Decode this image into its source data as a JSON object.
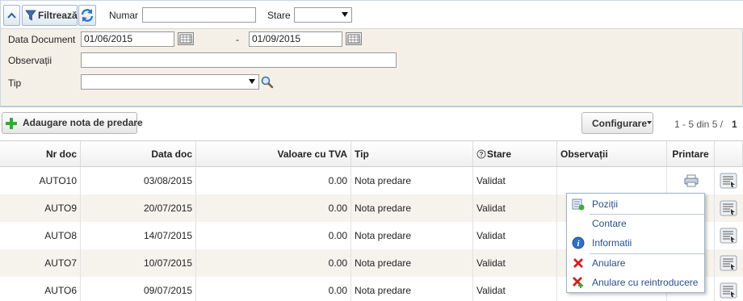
{
  "filter": {
    "toggle_label": "^",
    "filter_button_label": "Filtrează",
    "numar_label": "Numar",
    "numar_value": "",
    "stare_label": "Stare",
    "stare_value": "",
    "data_document_label": "Data Document",
    "date_from": "01/06/2015",
    "date_separator": "-",
    "date_to": "01/09/2015",
    "observatii_label": "Observații",
    "observatii_value": "",
    "tip_label": "Tip",
    "tip_value": ""
  },
  "actions": {
    "add_label": "Adaugare nota de predare",
    "config_label": "Configurare",
    "pagination_text": "1 - 5 din 5 /",
    "page_number": "1"
  },
  "table": {
    "columns": [
      "Nr doc",
      "Data doc",
      "Valoare cu TVA",
      "Tip",
      "Stare",
      "Observații",
      "Printare"
    ],
    "rows": [
      {
        "nr": "AUTO10",
        "data": "03/08/2015",
        "valoare": "0.00",
        "tip": "Nota predare",
        "stare": "Validat",
        "obs": ""
      },
      {
        "nr": "AUTO9",
        "data": "20/07/2015",
        "valoare": "0.00",
        "tip": "Nota predare",
        "stare": "Validat",
        "obs": ""
      },
      {
        "nr": "AUTO8",
        "data": "14/07/2015",
        "valoare": "0.00",
        "tip": "Nota predare",
        "stare": "Validat",
        "obs": ""
      },
      {
        "nr": "AUTO7",
        "data": "10/07/2015",
        "valoare": "0.00",
        "tip": "Nota predare",
        "stare": "Validat",
        "obs": ""
      },
      {
        "nr": "AUTO6",
        "data": "09/07/2015",
        "valoare": "0.00",
        "tip": "Nota predare",
        "stare": "Validat",
        "obs": ""
      }
    ]
  },
  "context_menu": {
    "items": [
      "Poziții",
      "Contare",
      "Informatii",
      "Anulare",
      "Anulare cu reintroducere"
    ]
  },
  "colors": {
    "panel_bg": "#f5f0e7",
    "alt_row_bg": "#f6f3ec",
    "menu_text": "#2a4f86",
    "add_green": "#3aa63a",
    "cancel_red": "#cc2222"
  },
  "icons": [
    "chevron-up-icon",
    "filter-funnel-icon",
    "refresh-icon",
    "calendar-icon",
    "search-magnifier-icon",
    "plus-icon",
    "dropdown-arrow-icon",
    "help-icon",
    "printer-icon",
    "actions-menu-icon",
    "positions-icon",
    "info-icon",
    "cancel-x-icon",
    "cancel-reintroduce-icon"
  ]
}
